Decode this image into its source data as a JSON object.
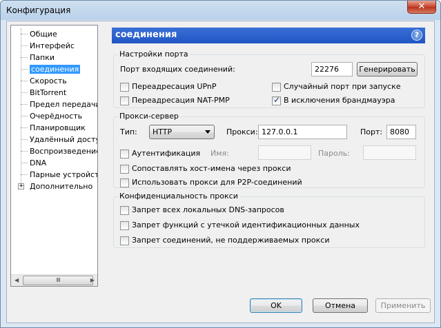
{
  "window": {
    "title": "Конфигурация",
    "close_glyph": "✕"
  },
  "tree": {
    "items": [
      {
        "label": "Общие"
      },
      {
        "label": "Интерфейс"
      },
      {
        "label": "Папки"
      },
      {
        "label": "соединения",
        "selected": true
      },
      {
        "label": "Скорость"
      },
      {
        "label": "BitTorrent"
      },
      {
        "label": "Предел передачи"
      },
      {
        "label": "Очерёдность"
      },
      {
        "label": "Планировщик"
      },
      {
        "label": "Удалённый доступ"
      },
      {
        "label": "Воспроизведение"
      },
      {
        "label": "DNA"
      },
      {
        "label": "Парные устройства"
      },
      {
        "label": "Дополнительно",
        "expander": "+"
      }
    ],
    "scroll_grip": "IIII"
  },
  "panel": {
    "title": "соединения",
    "help": "?"
  },
  "port_settings": {
    "legend": "Настройки порта",
    "incoming_port_label": "Порт входящих соединений:",
    "incoming_port_value": "22276",
    "generate_label": "Генерировать",
    "upnp_label": "Переадресация UPnP",
    "upnp_checked": false,
    "natpmp_label": "Переадресация NAT-PMP",
    "natpmp_checked": false,
    "random_port_label": "Случайный порт при запуске",
    "random_port_checked": false,
    "firewall_label": "В исключения брандмауэра",
    "firewall_checked": true
  },
  "proxy": {
    "legend": "Прокси-сервер",
    "type_label": "Тип:",
    "type_value": "HTTP",
    "proxy_label": "Прокси:",
    "proxy_value": "127.0.0.1",
    "port_label": "Порт:",
    "port_value": "8080",
    "auth_label": "Аутентификация",
    "auth_checked": false,
    "name_label": "Имя:",
    "password_label": "Пароль:",
    "resolve_label": "Сопоставлять хост-имена через прокси",
    "resolve_checked": false,
    "p2p_label": "Использовать прокси для P2P-соединений",
    "p2p_checked": false
  },
  "privacy": {
    "legend": "Конфиденциальность прокси",
    "dns_label": "Запрет всех локальных DNS-запросов",
    "dns_checked": false,
    "leak_label": "Запрет функций с утечкой идентификационных данных",
    "leak_checked": false,
    "unsupported_label": "Запрет соединений, не поддерживаемых прокси",
    "unsupported_checked": false
  },
  "buttons": {
    "ok": "OK",
    "cancel": "Отмена",
    "apply": "Применить"
  }
}
